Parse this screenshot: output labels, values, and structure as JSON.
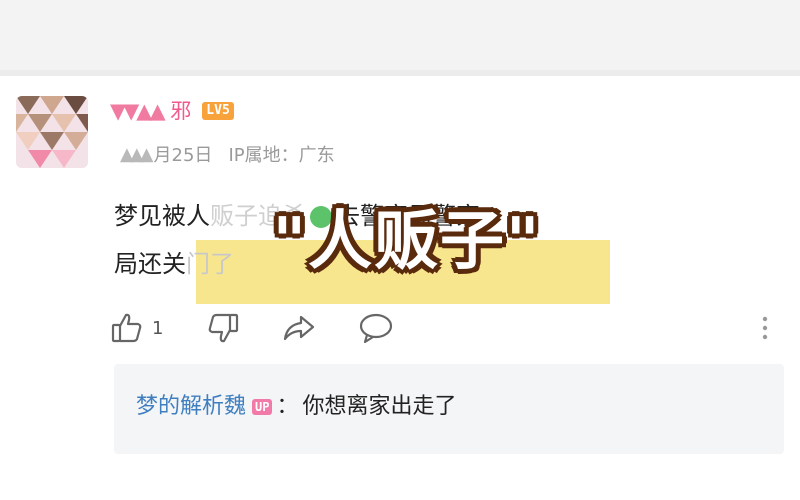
{
  "comment": {
    "username_mask": "▼▼▲▲",
    "username_suffix": "邪",
    "level": "LV5",
    "meta_mask": "▲▲▲",
    "date": "月25日",
    "ip": "IP属地：广东",
    "line1_a": "梦见被人",
    "line1_mask": "贩子追杀",
    "line1_b": "去警察局警察",
    "line2_a": "局还关",
    "line2_ghost": "门了",
    "like_count": "1"
  },
  "overlay": {
    "title": "\"人贩子\""
  },
  "reply": {
    "author": "梦的解析魏",
    "badge": "UP",
    "colon": "：",
    "text": "你想离家出走了"
  },
  "colors": {
    "accent_pink": "#f05a8c",
    "level_badge": "#f7a23b",
    "reply_author": "#3f7fc0",
    "highlight": "#f7e27a"
  },
  "icons": [
    "avatar-mosaic",
    "thumbs-up-icon",
    "thumbs-down-icon",
    "share-icon",
    "comment-icon",
    "more-vertical-icon"
  ]
}
